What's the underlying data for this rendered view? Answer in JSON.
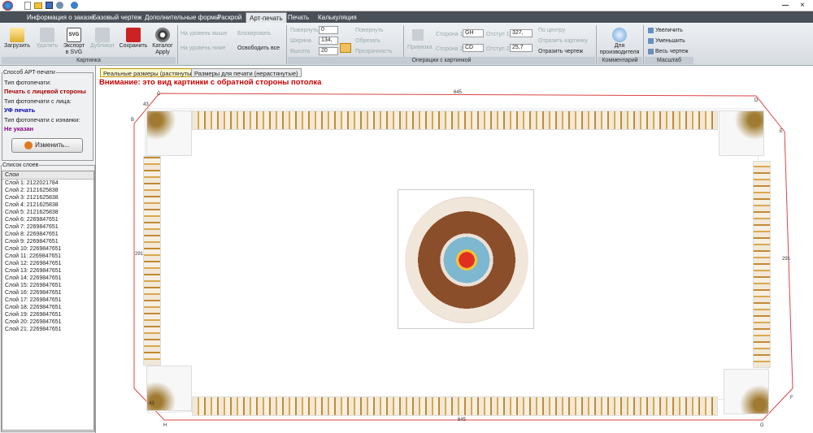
{
  "menu": {
    "tabs": [
      "Информация о заказе",
      "Базовый чертеж",
      "Дополнительные формы",
      "Раскрой",
      "Арт-печать",
      "Печать",
      "Калькуляция"
    ]
  },
  "ribbon": {
    "load": "Загрузить",
    "delete": "Удалить",
    "export_svg": "Экспорт в SVG",
    "duplicate": "Дубликат",
    "save": "Сохранить",
    "catalog": "Каталог Apply",
    "group_picture": "Картинка",
    "level_up": "На уровень выше",
    "level_down": "На уровень ниже",
    "lock": "Блокировать",
    "free_all": "Освободить все",
    "rotate_label": "Повернуть",
    "rotate_value": "0",
    "width_label": "Ширина",
    "width_value": "134,",
    "height_label": "Высота",
    "height_value": "20",
    "rotate_btn": "Повернуть",
    "crop_btn": "Обрезать",
    "transparency_btn": "Прозрачность",
    "snap": "Привязка",
    "side1_label": "Сторона 1",
    "side1_value": "GH",
    "side2_label": "Сторона 2",
    "side2_value": "CD",
    "offset1_label": "Отступ 1",
    "offset1_value": "327,",
    "offset2_label": "Отступ 2",
    "offset2_value": "25,7",
    "center": "По центру",
    "mirror_picture": "Отразить картинку",
    "mirror_drawing": "Отразить чертеж",
    "group_ops": "Операции с картинкой",
    "for_producer": "Для производителя",
    "group_comment": "Комментарий",
    "zoom_in": "Увеличить",
    "zoom_out": "Уменьшить",
    "whole": "Весь чертеж",
    "group_scale": "Масштаб"
  },
  "left": {
    "art_group": "Способ АРТ-печати",
    "photo_type": "Тип фотопечати:",
    "photo_type_val": "Печать с лицевой стороны",
    "front_type": "Тип фотопечати с лица:",
    "front_type_val": "УФ печать",
    "back_type": "Тип фотопечати с изнанки:",
    "back_type_val": "Не указан",
    "change_btn": "Изменить...",
    "layers_group": "Список слоев",
    "layers_header": "Слои",
    "layers": [
      "Слой 1: 2122021784",
      "Слой 2: 2121625838",
      "Слой 3: 2121625838",
      "Слой 4: 2121625838",
      "Слой 5: 2121625838",
      "Слой 6: 2269847651",
      "Слой 7: 2269847651",
      "Слой 8: 2269847651",
      "Слой 9: 2269847651",
      "Слой 10: 2269847651",
      "Слой 11: 2269847651",
      "Слой 12: 2269847651",
      "Слой 13: 2269847651",
      "Слой 14: 2269847651",
      "Слой 15: 2269847651",
      "Слой 16: 2269847651",
      "Слой 17: 2269847651",
      "Слой 18: 2269847651",
      "Слой 19: 2269847651",
      "Слой 20: 2269847651",
      "Слой 21: 2269847651"
    ]
  },
  "view": {
    "tab_real": "Реальные размеры (растянутые)",
    "tab_print": "Размеры для печати (нерастянутые)",
    "warning": "Внимание: это вид картинки с обратной стороны потолка",
    "dims": {
      "top": "645",
      "bottom": "645",
      "left": "291",
      "right": "291",
      "c43a": "43",
      "c43b": "43"
    },
    "points": {
      "c": "C",
      "d": "D",
      "e": "E",
      "f": "F",
      "g": "G",
      "h": "H",
      "b": "B"
    }
  },
  "colors": {
    "accent": "#cc0000",
    "menubar": "#4a5058"
  }
}
